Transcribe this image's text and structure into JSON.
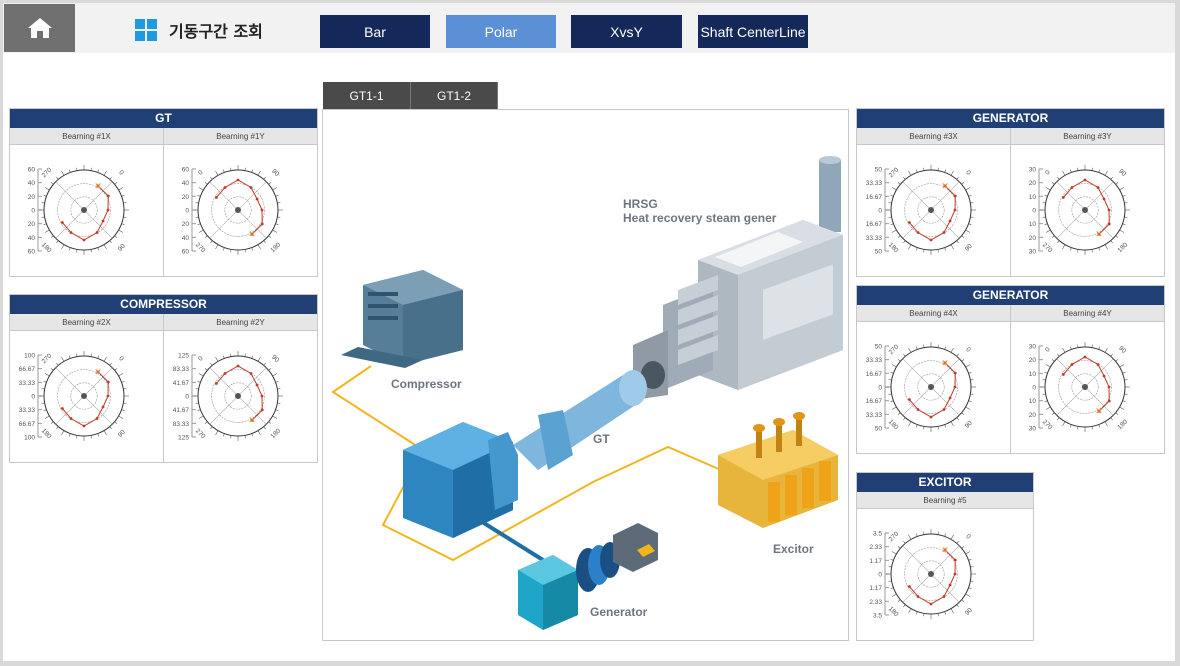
{
  "header": {
    "title": "기동구간 조회",
    "tabs": [
      {
        "label": "Bar",
        "active": false
      },
      {
        "label": "Polar",
        "active": true
      },
      {
        "label": "XvsY",
        "active": false
      },
      {
        "label": "Shaft CenterLine",
        "active": false
      }
    ]
  },
  "colors": {
    "nav_dark": "#14285a",
    "nav_active": "#5b8fd6",
    "panel_header": "#203f74",
    "trace": "#c0392b",
    "marker": "#e67e22"
  },
  "view_tabs": [
    "GT1-1",
    "GT1-2"
  ],
  "diagram": {
    "hrsg_label": "HRSG",
    "hrsg_sub": "Heat recovery steam gener",
    "compressor_label": "Compressor",
    "gt_label": "GT",
    "generator_label": "Generator",
    "excitor_label": "Excitor"
  },
  "panels": {
    "gt": {
      "title": "GT",
      "plots": [
        {
          "name": "Bearning #1X",
          "ticks": [
            "60",
            "40",
            "20",
            "0",
            "20",
            "40",
            "60"
          ],
          "angles": [
            "270",
            "0",
            "90",
            "180"
          ]
        },
        {
          "name": "Bearning #1Y",
          "ticks": [
            "60",
            "40",
            "20",
            "0",
            "20",
            "40",
            "60"
          ],
          "angles": [
            "0",
            "90",
            "180",
            "270"
          ]
        }
      ]
    },
    "compressor": {
      "title": "COMPRESSOR",
      "plots": [
        {
          "name": "Bearning #2X",
          "ticks": [
            "100",
            "66.67",
            "33.33",
            "0",
            "33.33",
            "66.67",
            "100"
          ],
          "angles": [
            "270",
            "0",
            "90",
            "180"
          ]
        },
        {
          "name": "Bearning #2Y",
          "ticks": [
            "125",
            "83.33",
            "41.67",
            "0",
            "41.67",
            "83.33",
            "125"
          ],
          "angles": [
            "0",
            "90",
            "180",
            "270"
          ]
        }
      ]
    },
    "generator_top": {
      "title": "GENERATOR",
      "plots": [
        {
          "name": "Bearning #3X",
          "ticks": [
            "50",
            "33.33",
            "16.67",
            "0",
            "16.67",
            "33.33",
            "50"
          ],
          "angles": [
            "270",
            "0",
            "90",
            "180"
          ]
        },
        {
          "name": "Bearning #3Y",
          "ticks": [
            "30",
            "20",
            "10",
            "0",
            "10",
            "20",
            "30"
          ],
          "angles": [
            "0",
            "90",
            "180",
            "270"
          ]
        }
      ]
    },
    "generator_bottom": {
      "title": "GENERATOR",
      "plots": [
        {
          "name": "Bearning #4X",
          "ticks": [
            "50",
            "33.33",
            "16.67",
            "0",
            "16.67",
            "33.33",
            "50"
          ],
          "angles": [
            "270",
            "0",
            "90",
            "180"
          ]
        },
        {
          "name": "Bearning #4Y",
          "ticks": [
            "30",
            "20",
            "10",
            "0",
            "10",
            "20",
            "30"
          ],
          "angles": [
            "0",
            "90",
            "180",
            "270"
          ]
        }
      ]
    },
    "excitor": {
      "title": "EXCITOR",
      "plots": [
        {
          "name": "Bearning #5",
          "ticks": [
            "3.5",
            "2.33",
            "1.17",
            "0",
            "1.17",
            "2.33",
            "3.5"
          ],
          "angles": [
            "270",
            "0",
            "90",
            "180"
          ]
        }
      ]
    }
  }
}
